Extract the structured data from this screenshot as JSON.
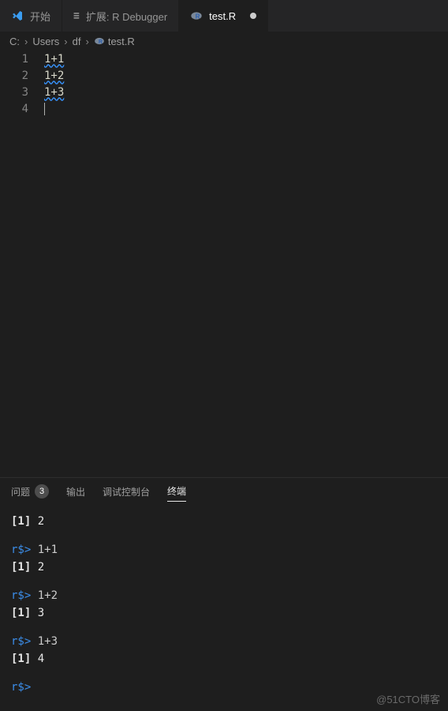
{
  "tabs": [
    {
      "label": "开始",
      "icon": "vscode"
    },
    {
      "label": "扩展: R Debugger",
      "icon": "ext"
    },
    {
      "label": "test.R",
      "icon": "r",
      "dirty": true
    }
  ],
  "breadcrumbs": {
    "c": "C:",
    "users": "Users",
    "df": "df",
    "file": "test.R"
  },
  "editor": {
    "lines": [
      {
        "num": "1",
        "code": "1+1"
      },
      {
        "num": "2",
        "code": "1+2"
      },
      {
        "num": "3",
        "code": "1+3"
      },
      {
        "num": "4",
        "code": ""
      }
    ]
  },
  "panel": {
    "tabs": {
      "problems": "问题",
      "problems_count": "3",
      "output": "输出",
      "debug_console": "调试控制台",
      "terminal": "终端"
    }
  },
  "terminal": {
    "prompt": "r$>",
    "first_result_idx": "[1]",
    "first_result_val": "2",
    "blocks": [
      {
        "cmd": "1+1",
        "idx": "[1]",
        "val": "2"
      },
      {
        "cmd": "1+2",
        "idx": "[1]",
        "val": "3"
      },
      {
        "cmd": "1+3",
        "idx": "[1]",
        "val": "4"
      }
    ]
  },
  "watermark": "@51CTO博客"
}
